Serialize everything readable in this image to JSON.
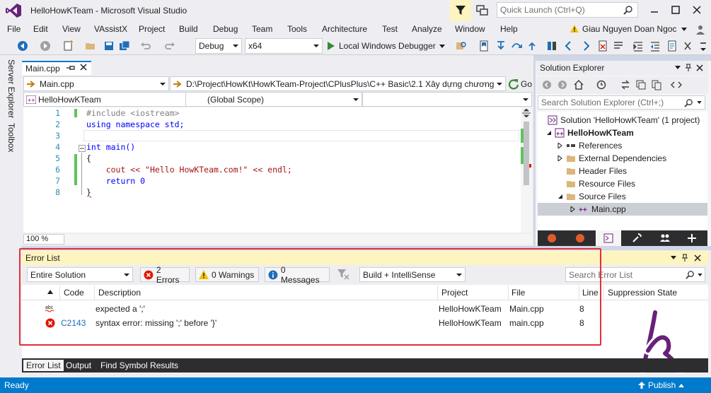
{
  "window": {
    "title": "HelloHowKTeam - Microsoft Visual Studio",
    "quick_launch_placeholder": "Quick Launch (Ctrl+Q)"
  },
  "menu": [
    "File",
    "Edit",
    "View",
    "VAssistX",
    "Project",
    "Build",
    "Debug",
    "Team",
    "Tools",
    "Architecture",
    "Test",
    "Analyze",
    "Window",
    "Help"
  ],
  "user": {
    "name": "Giau Nguyen Doan Ngoc"
  },
  "toolbar": {
    "config": "Debug",
    "platform": "x64",
    "debugger": "Local Windows Debugger"
  },
  "left_strip": {
    "server_explorer": "Server Explorer",
    "toolbox": "Toolbox"
  },
  "editor": {
    "tab": "Main.cpp",
    "nav_file": "Main.cpp",
    "nav_path": "D:\\Project\\HowKt\\HowKTeam-Project\\CPlusPlus\\C++ Basic\\2.1 Xây dựng chương",
    "go_label": "Go",
    "project_combo": "HelloHowKTeam",
    "scope_combo": "(Global Scope)",
    "zoom": "100 %",
    "lines": [
      {
        "num": "1",
        "text": "#include <iostream>"
      },
      {
        "num": "2",
        "text": "using namespace std;"
      },
      {
        "num": "3",
        "text": ""
      },
      {
        "num": "4",
        "text": "int main()"
      },
      {
        "num": "5",
        "text": "{"
      },
      {
        "num": "6",
        "text": "    cout << \"Hello HowKTeam.com!\" << endl;"
      },
      {
        "num": "7",
        "text": "    return 0"
      },
      {
        "num": "8",
        "text": "}"
      }
    ]
  },
  "solution_explorer": {
    "title": "Solution Explorer",
    "search_placeholder": "Search Solution Explorer (Ctrl+;)",
    "items": [
      {
        "label": "Solution 'HelloHowKTeam' (1 project)"
      },
      {
        "label": "HelloHowKTeam"
      },
      {
        "label": "References"
      },
      {
        "label": "External Dependencies"
      },
      {
        "label": "Header Files"
      },
      {
        "label": "Resource Files"
      },
      {
        "label": "Source Files"
      },
      {
        "label": "Main.cpp"
      }
    ]
  },
  "error_list": {
    "title": "Error List",
    "scope": "Entire Solution",
    "errors_btn": "2 Errors",
    "warnings_btn": "0 Warnings",
    "messages_btn": "0 Messages",
    "build_filter": "Build + IntelliSense",
    "search_placeholder": "Search Error List",
    "columns": [
      "Code",
      "Description",
      "Project",
      "File",
      "Line",
      "Suppression State"
    ],
    "rows": [
      {
        "code": "",
        "description": "expected a ';'",
        "project": "HelloHowKTeam",
        "file": "Main.cpp",
        "line": "8"
      },
      {
        "code": "C2143",
        "description": "syntax error: missing ';' before '}'",
        "project": "HelloHowKTeam",
        "file": "main.cpp",
        "line": "8"
      }
    ]
  },
  "bottom_tabs": [
    "Error List",
    "Output",
    "Find Symbol Results"
  ],
  "status": {
    "left": "Ready",
    "right": "Publish"
  },
  "colors": {
    "accent": "#007acc",
    "vs_purple": "#68217a",
    "error_red": "#e51400",
    "highlight_red": "#e0303a"
  }
}
